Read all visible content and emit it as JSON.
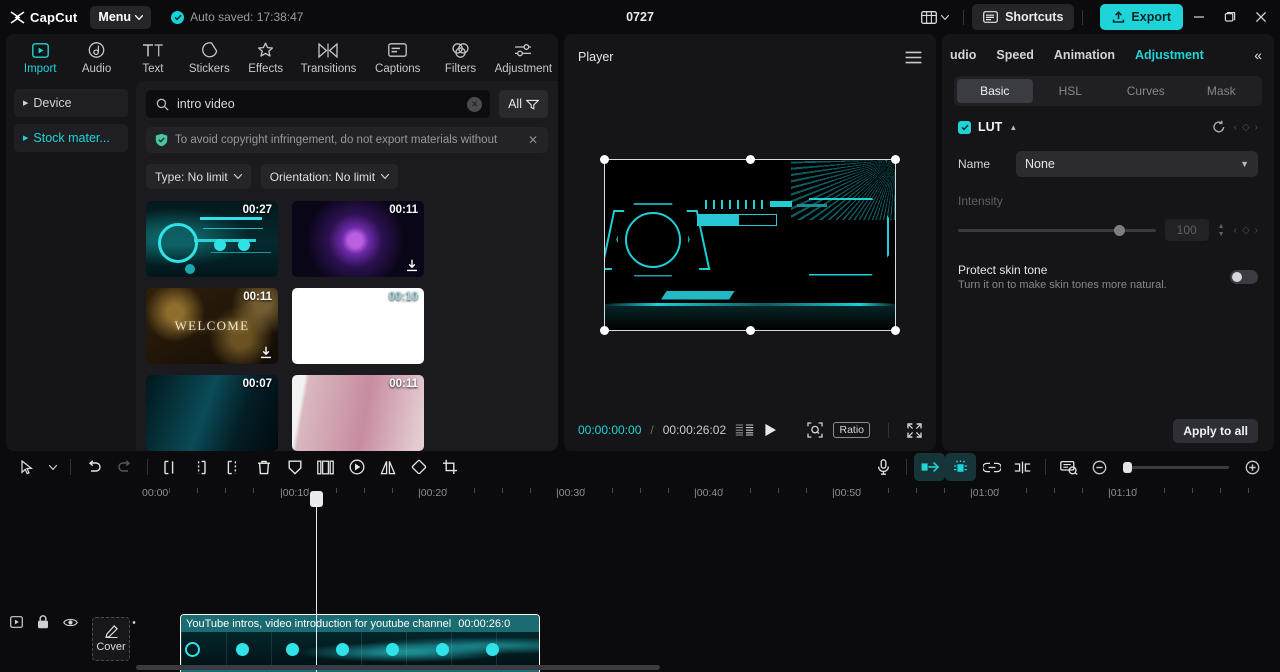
{
  "titlebar": {
    "logo_text": "CapCut",
    "menu_label": "Menu",
    "autosave_text": "Auto saved: 17:38:47",
    "project_title": "0727",
    "shortcuts_label": "Shortcuts",
    "export_label": "Export",
    "accent_color": "#1fd4d8"
  },
  "toolbar_tabs": [
    {
      "label": "Import",
      "icon": "import-icon",
      "active": true
    },
    {
      "label": "Audio",
      "icon": "audio-icon",
      "active": false
    },
    {
      "label": "Text",
      "icon": "text-icon",
      "active": false
    },
    {
      "label": "Stickers",
      "icon": "stickers-icon",
      "active": false
    },
    {
      "label": "Effects",
      "icon": "effects-icon",
      "active": false
    },
    {
      "label": "Transitions",
      "icon": "transitions-icon",
      "active": false
    },
    {
      "label": "Captions",
      "icon": "captions-icon",
      "active": false
    },
    {
      "label": "Filters",
      "icon": "filters-icon",
      "active": false
    },
    {
      "label": "Adjustment",
      "icon": "adjustment-icon",
      "active": false
    }
  ],
  "media_panel": {
    "nav_items": [
      {
        "label": "Device",
        "active": false
      },
      {
        "label": "Stock mater...",
        "active": true
      }
    ],
    "search": {
      "value": "intro video",
      "placeholder": "Search"
    },
    "all_button": "All",
    "notice": "To avoid copyright infringement, do not export materials without",
    "filters": [
      {
        "label": "Type: No limit"
      },
      {
        "label": "Orientation: No limit"
      }
    ],
    "thumbnails": [
      {
        "duration": "00:27",
        "style": "tb-cyan",
        "downloadable": false,
        "caption": ""
      },
      {
        "duration": "00:11",
        "style": "tb-planet",
        "downloadable": true,
        "caption": ""
      },
      {
        "duration": "00:11",
        "style": "tb-gold",
        "downloadable": true,
        "caption": "WELCOME"
      },
      {
        "duration": "00:10",
        "style": "tb-white",
        "downloadable": false,
        "caption": ""
      },
      {
        "duration": "00:07",
        "style": "tb-blue",
        "downloadable": false,
        "caption": ""
      },
      {
        "duration": "00:11",
        "style": "tb-pink",
        "downloadable": false,
        "caption": ""
      }
    ]
  },
  "player": {
    "title": "Player",
    "current_time": "00:00:00:00",
    "separator": "/",
    "total_time": "00:00:26:02",
    "ratio_label": "Ratio"
  },
  "right_panel": {
    "tabs": [
      {
        "label": "udio",
        "active": false
      },
      {
        "label": "Speed",
        "active": false
      },
      {
        "label": "Animation",
        "active": false
      },
      {
        "label": "Adjustment",
        "active": true
      }
    ],
    "collapse_icon": "«",
    "subtabs": [
      {
        "label": "Basic",
        "active": true
      },
      {
        "label": "HSL",
        "active": false
      },
      {
        "label": "Curves",
        "active": false
      },
      {
        "label": "Mask",
        "active": false
      }
    ],
    "lut": {
      "title": "LUT",
      "enabled": true,
      "name_label": "Name",
      "name_value": "None",
      "intensity_label": "Intensity",
      "intensity_value": "100"
    },
    "skin_tone": {
      "title": "Protect skin tone",
      "subtitle": "Turn it on to make skin tones more natural.",
      "enabled": false
    },
    "apply_all_label": "Apply to all"
  },
  "timeline": {
    "ruler_ticks": [
      "00:00",
      "00:10",
      "00:20",
      "00:30",
      "00:40",
      "00:50",
      "01:00",
      "01:10"
    ],
    "clip": {
      "title": "YouTube intros, video introduction for youtube channel",
      "duration": "00:00:26:0"
    },
    "cover_label": "Cover"
  }
}
